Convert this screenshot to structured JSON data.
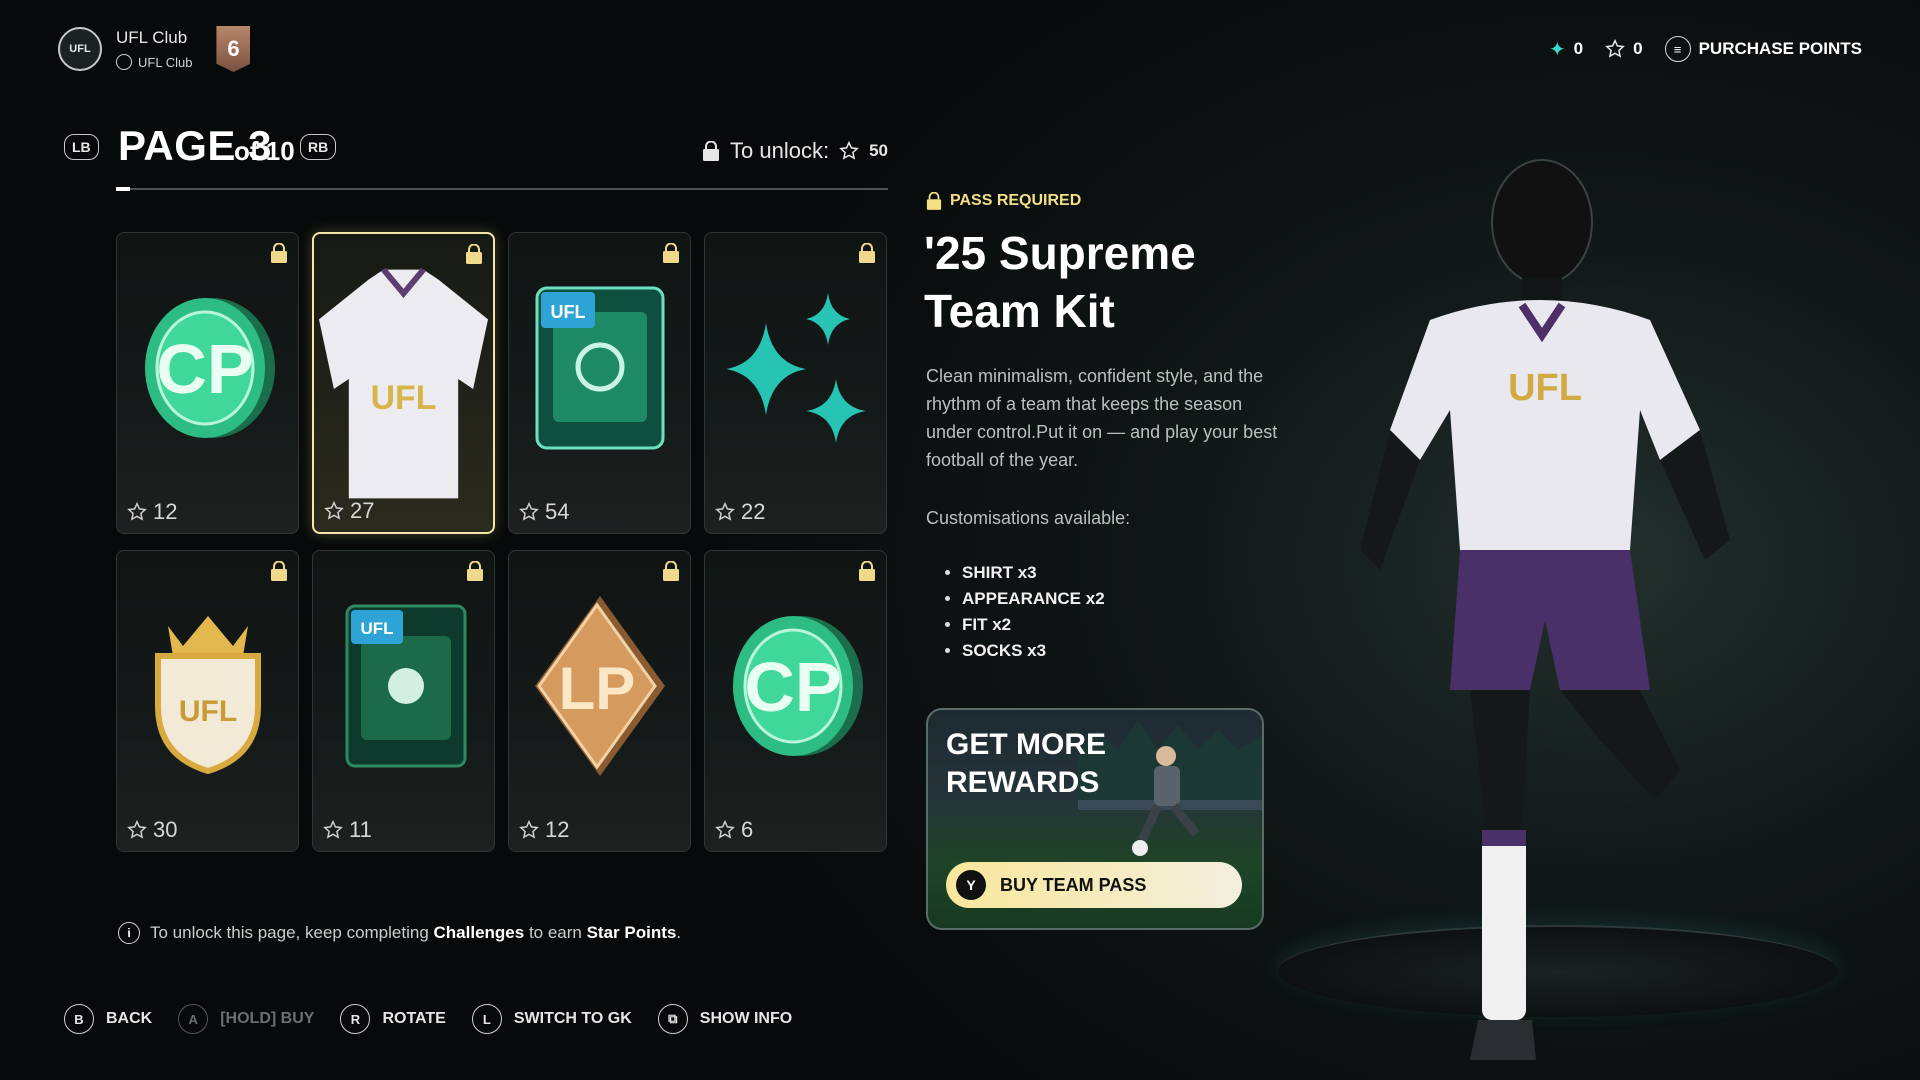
{
  "club": {
    "logo_text": "UFL",
    "name": "UFL Club",
    "sub_name": "UFL Club",
    "rank": "6"
  },
  "currency": {
    "sparks": "0",
    "star_points": "0",
    "purchase_label": "PURCHASE POINTS"
  },
  "page": {
    "lb": "LB",
    "rb": "RB",
    "label": "PAGE 3",
    "of": "of 10",
    "unlock_label": "To unlock:",
    "unlock_cost": "50"
  },
  "cards": [
    {
      "name": "cp-coin",
      "cost": "12"
    },
    {
      "name": "supreme-kit",
      "cost": "27"
    },
    {
      "name": "card-pack",
      "cost": "54"
    },
    {
      "name": "sparkles",
      "cost": "22"
    },
    {
      "name": "club-crest",
      "cost": "30"
    },
    {
      "name": "green-pack",
      "cost": "11"
    },
    {
      "name": "lp-token",
      "cost": "12"
    },
    {
      "name": "cp-coin-2",
      "cost": "6"
    }
  ],
  "detail": {
    "pass_required": "PASS REQUIRED",
    "title": "'25 Supreme Team Kit",
    "description": "Clean minimalism, confident style, and the rhythm of a team that keeps the season under control.Put it on — and play your best football of the year.",
    "custom_label": "Customisations available:",
    "customisations": [
      "SHIRT x3",
      "APPEARANCE x2",
      "FIT x2",
      "SOCKS x3"
    ]
  },
  "promo": {
    "title_line1": "GET MORE",
    "title_line2": "REWARDS",
    "button_key": "Y",
    "button_label": "BUY TEAM PASS"
  },
  "info": {
    "prefix": "To unlock this page, keep completing ",
    "challenges": "Challenges",
    "middle": " to earn ",
    "star_points": "Star Points",
    "suffix": "."
  },
  "footer": {
    "back_key": "B",
    "back": "BACK",
    "buy_key": "A",
    "buy": "[HOLD] BUY",
    "rotate_key": "R",
    "rotate": "ROTATE",
    "switch_key": "L",
    "switch": "SWITCH TO GK",
    "info": "SHOW INFO"
  },
  "colors": {
    "accent_gold": "#f4df84",
    "accent_teal": "#3dd9c8",
    "selected_border": "#f2e7a3"
  }
}
